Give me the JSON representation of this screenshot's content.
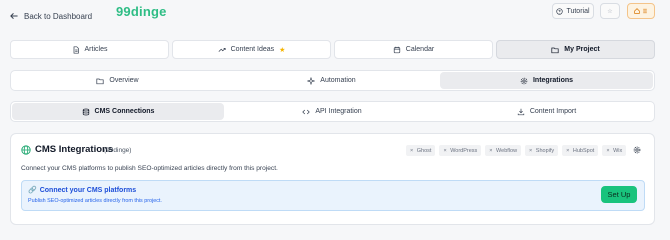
{
  "header": {
    "back_label": "Back to Dashboard",
    "brand": "99dinge",
    "tutorial_label": "Tutorial",
    "star_button_glyph": "☆",
    "account_glyph": "⌂ ≡"
  },
  "main_tabs": [
    {
      "label": "Articles",
      "icon": "document-icon",
      "active": false
    },
    {
      "label": "Content Ideas",
      "icon": "trend-icon",
      "badge": "★",
      "active": false
    },
    {
      "label": "Calendar",
      "icon": "calendar-icon",
      "active": false
    },
    {
      "label": "My Project",
      "icon": "folder-icon",
      "active": true
    }
  ],
  "sub_tabs": [
    {
      "label": "Overview",
      "icon": "folder-icon",
      "active": false
    },
    {
      "label": "Automation",
      "icon": "sparkle-icon",
      "active": false
    },
    {
      "label": "Integrations",
      "icon": "gear-icon",
      "active": true
    }
  ],
  "integration_tabs": [
    {
      "label": "CMS Connections",
      "icon": "database-icon",
      "active": true
    },
    {
      "label": "API Integration",
      "icon": "code-icon",
      "active": false
    },
    {
      "label": "Content Import",
      "icon": "download-icon",
      "active": false
    }
  ],
  "cms": {
    "title": "CMS Integrations",
    "project_tag": "(99dinge)",
    "platforms": [
      "Ghost",
      "WordPress",
      "Webflow",
      "Shopify",
      "HubSpot",
      "Wix"
    ],
    "description": "Connect your CMS platforms to publish SEO-optimized articles directly from this project.",
    "banner_title": "Connect your CMS platforms",
    "banner_emoji": "🔗",
    "banner_subtitle": "Publish SEO-optimized articles directly from this project.",
    "setup_label": "Set Up"
  },
  "colors": {
    "brand": "#2ebd85",
    "setup_button": "#19c37d",
    "banner_bg": "#eaf3fd",
    "banner_text": "#1d4ed8"
  }
}
